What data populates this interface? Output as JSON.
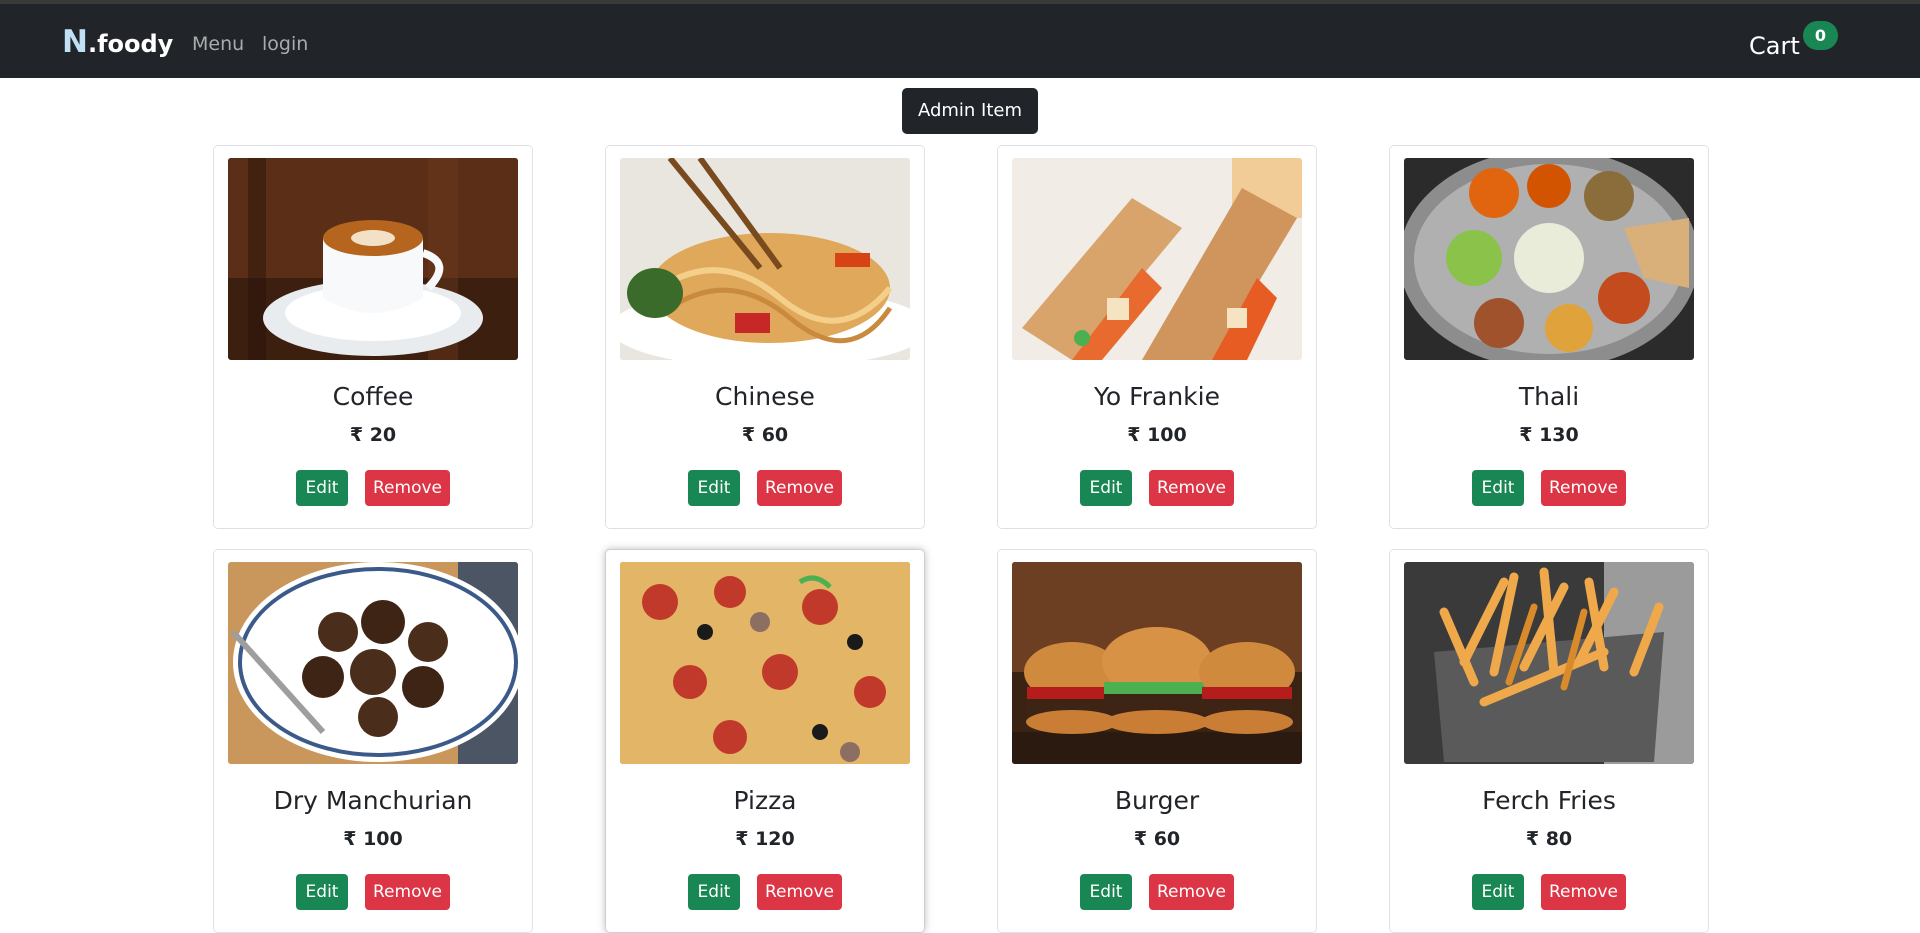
{
  "navbar": {
    "brand_letter": "N",
    "brand_rest": ".foody",
    "links": [
      "Menu",
      "login"
    ],
    "cart_label": "Cart",
    "cart_count": "0"
  },
  "admin_button": "Admin Item",
  "actions": {
    "edit": "Edit",
    "remove": "Remove"
  },
  "items": [
    {
      "name": "Coffee",
      "price": "₹ 20"
    },
    {
      "name": "Chinese",
      "price": "₹ 60"
    },
    {
      "name": "Yo Frankie",
      "price": "₹ 100"
    },
    {
      "name": "Thali",
      "price": "₹ 130"
    },
    {
      "name": "Dry Manchurian",
      "price": "₹ 100"
    },
    {
      "name": "Pizza",
      "price": "₹ 120"
    },
    {
      "name": "Burger",
      "price": "₹ 60"
    },
    {
      "name": "Ferch Fries",
      "price": "₹ 80"
    }
  ],
  "colors": {
    "navbar": "#212529",
    "edit_button": "#198754",
    "remove_button": "#dc3545",
    "cart_badge": "#198754"
  }
}
